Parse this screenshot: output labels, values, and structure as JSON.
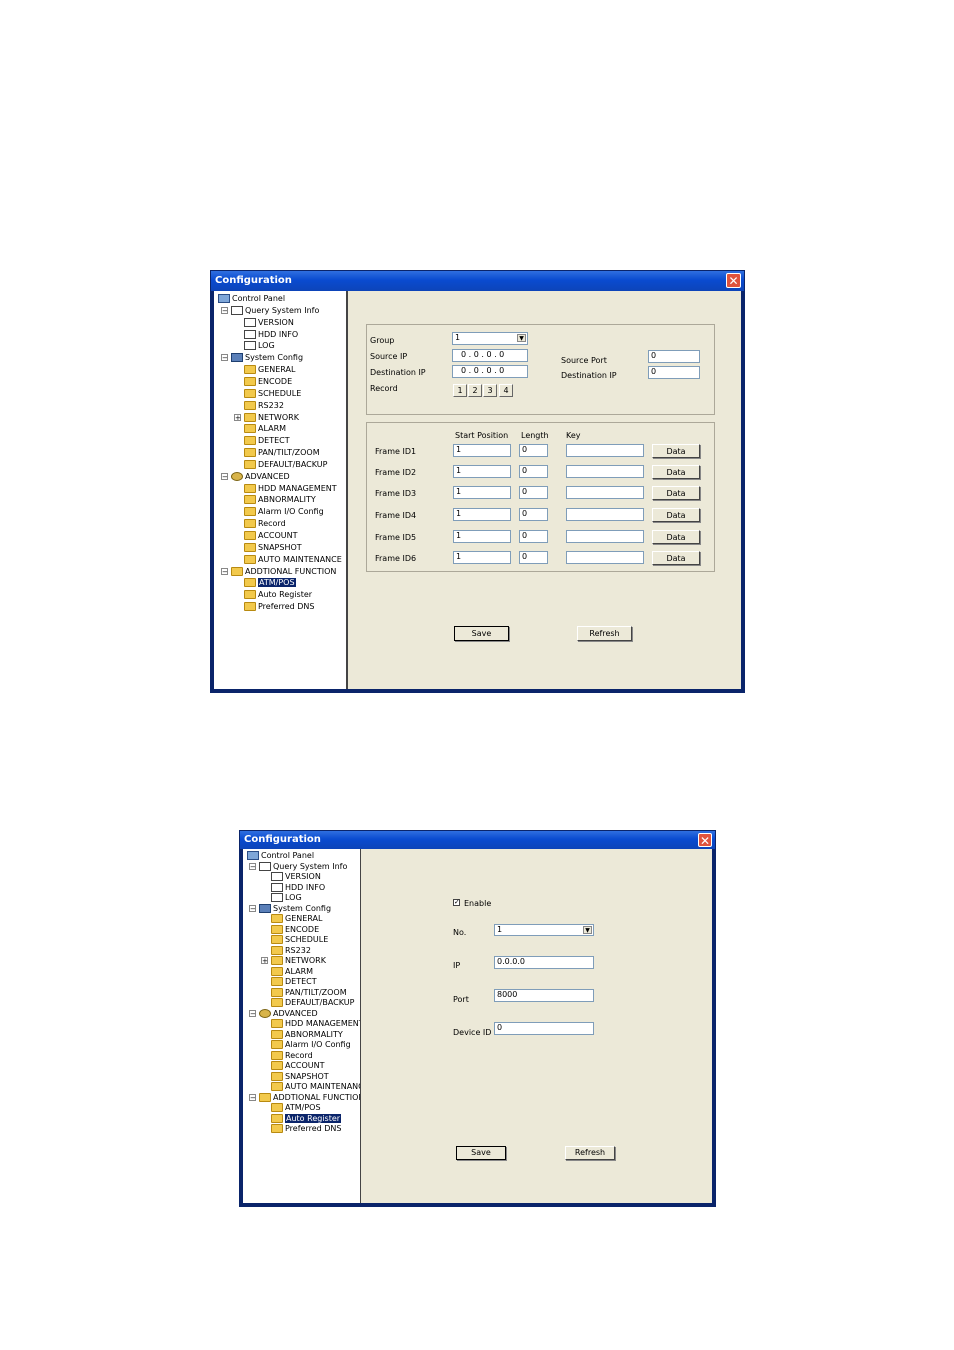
{
  "window1": {
    "title": "Configuration",
    "tree": [
      {
        "label": "Control Panel",
        "icon": "pc-icon"
      },
      {
        "label": "Query System Info",
        "icon": "note-icon"
      },
      {
        "label": "VERSION",
        "icon": "note-icon"
      },
      {
        "label": "HDD INFO",
        "icon": "note-icon"
      },
      {
        "label": "LOG",
        "icon": "note-icon"
      },
      {
        "label": "System Config",
        "icon": "tool-icon"
      },
      {
        "label": "GENERAL",
        "icon": "folder-icon"
      },
      {
        "label": "ENCODE",
        "icon": "folder-icon"
      },
      {
        "label": "SCHEDULE",
        "icon": "folder-icon"
      },
      {
        "label": "RS232",
        "icon": "folder-icon"
      },
      {
        "label": "NETWORK",
        "icon": "folder-icon"
      },
      {
        "label": "ALARM",
        "icon": "folder-icon"
      },
      {
        "label": "DETECT",
        "icon": "folder-icon"
      },
      {
        "label": "PAN/TILT/ZOOM",
        "icon": "folder-icon"
      },
      {
        "label": "DEFAULT/BACKUP",
        "icon": "folder-icon"
      },
      {
        "label": "ADVANCED",
        "icon": "gear-icon"
      },
      {
        "label": "HDD MANAGEMENT",
        "icon": "folder-icon"
      },
      {
        "label": "ABNORMALITY",
        "icon": "folder-icon"
      },
      {
        "label": "Alarm I/O Config",
        "icon": "folder-icon"
      },
      {
        "label": "Record",
        "icon": "folder-icon"
      },
      {
        "label": "ACCOUNT",
        "icon": "folder-icon"
      },
      {
        "label": "SNAPSHOT",
        "icon": "folder-icon"
      },
      {
        "label": "AUTO MAINTENANCE",
        "icon": "folder-icon"
      },
      {
        "label": "ADDTIONAL FUNCTION",
        "icon": "folder-icon"
      },
      {
        "label": "ATM/POS",
        "icon": "folder-icon"
      },
      {
        "label": "Auto Register",
        "icon": "folder-icon"
      },
      {
        "label": "Preferred DNS",
        "icon": "folder-icon"
      }
    ],
    "expanders": [
      "−",
      "−",
      "+",
      "−",
      "−"
    ],
    "selected_item": "ATM/POS",
    "form": {
      "group_label": "Group",
      "group_value": "1",
      "source_ip_label": "Source IP",
      "source_ip_value": "0 . 0 . 0 . 0",
      "destination_ip_label": "Destination IP",
      "destination_ip_value": "0 . 0 . 0 . 0",
      "source_port_label": "Source Port",
      "source_port_value": "0",
      "destination_ip2_label": "Destination IP",
      "destination_ip2_value": "0",
      "record_label": "Record",
      "record_buttons": [
        "1",
        "2",
        "3",
        "4"
      ],
      "col_start": "Start Position",
      "col_length": "Length",
      "col_key": "Key",
      "frames": [
        {
          "label": "Frame ID1",
          "start": "1",
          "length": "0",
          "key": "",
          "btn": "Data"
        },
        {
          "label": "Frame ID2",
          "start": "1",
          "length": "0",
          "key": "",
          "btn": "Data"
        },
        {
          "label": "Frame ID3",
          "start": "1",
          "length": "0",
          "key": "",
          "btn": "Data"
        },
        {
          "label": "Frame ID4",
          "start": "1",
          "length": "0",
          "key": "",
          "btn": "Data"
        },
        {
          "label": "Frame ID5",
          "start": "1",
          "length": "0",
          "key": "",
          "btn": "Data"
        },
        {
          "label": "Frame ID6",
          "start": "1",
          "length": "0",
          "key": "",
          "btn": "Data"
        }
      ],
      "save_label": "Save",
      "refresh_label": "Refresh"
    }
  },
  "window2": {
    "title": "Configuration",
    "selected_item": "Auto Register",
    "form": {
      "enable_label": "Enable",
      "enable_checked": true,
      "check_mark": "✓",
      "no_label": "No.",
      "no_value": "1",
      "ip_label": "IP",
      "ip_value": "0.0.0.0",
      "port_label": "Port",
      "port_value": "8000",
      "device_id_label": "Device ID",
      "device_id_value": "0",
      "save_label": "Save",
      "refresh_label": "Refresh"
    }
  },
  "close_glyph": "✕",
  "dropdown_glyph": "▼"
}
